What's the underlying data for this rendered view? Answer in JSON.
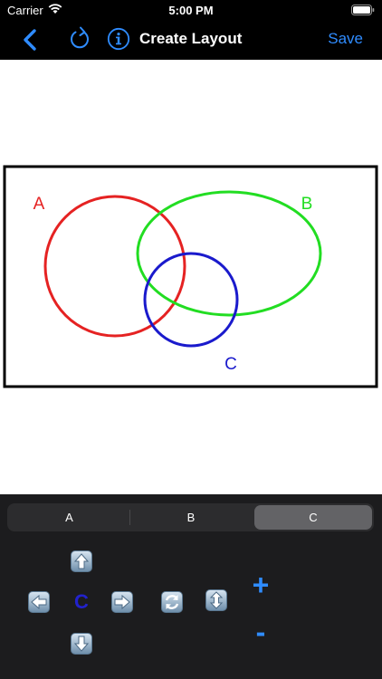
{
  "status_bar": {
    "carrier": "Carrier",
    "time": "5:00 PM"
  },
  "nav": {
    "title": "Create Layout",
    "save_label": "Save",
    "accent_color": "#2f8cff"
  },
  "diagram": {
    "labels": {
      "a": "A",
      "b": "B",
      "c": "C"
    },
    "colors": {
      "a": "#e52222",
      "b": "#22dd22",
      "c": "#1a1acc"
    }
  },
  "segmented_control": {
    "options": [
      "A",
      "B",
      "C"
    ],
    "selected": "C"
  },
  "controls": {
    "selected_set_label": "C",
    "plus_label": "+",
    "minus_label": "-"
  }
}
